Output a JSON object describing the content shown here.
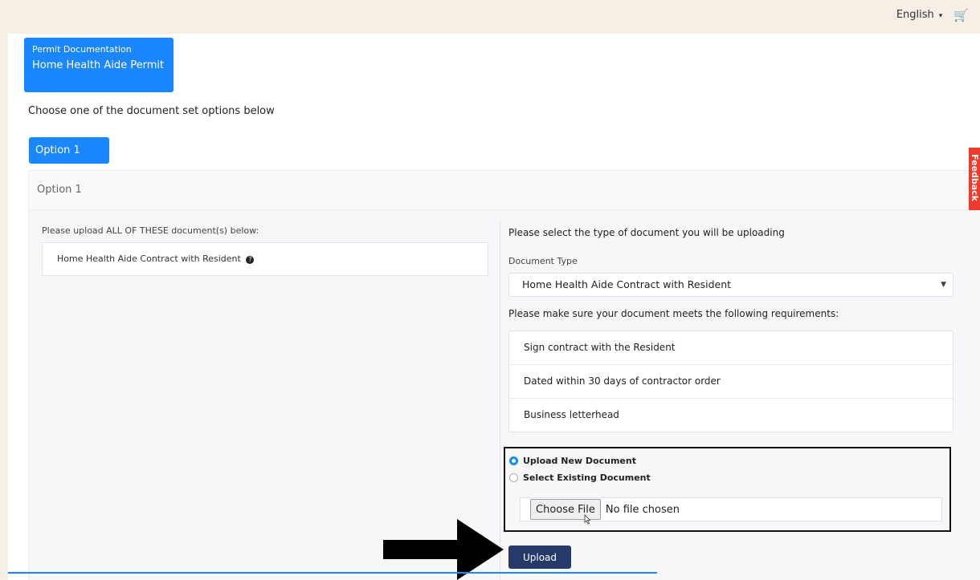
{
  "header": {
    "language": "English",
    "language_caret": "▾",
    "cart_icon": "🛒"
  },
  "permit": {
    "label": "Permit Documentation",
    "name": "Home Health Aide Permit"
  },
  "instructions": "Choose one of the document set options below",
  "option_tab": {
    "label": "Option 1"
  },
  "option_card": {
    "title": "Option 1",
    "left": {
      "label": "Please upload ALL OF THESE document(s) below:",
      "documents": [
        "Home Health Aide Contract with Resident"
      ]
    },
    "right": {
      "heading": "Please select the type of document you will be uploading",
      "doc_type_label": "Document Type",
      "doc_type_value": "Home Health Aide Contract with Resident",
      "requirements_heading": "Please make sure your document meets the following requirements:",
      "requirements": [
        "Sign contract with the Resident",
        "Dated within 30 days of contractor order",
        "Business letterhead"
      ],
      "radio_upload_new": "Upload New Document",
      "radio_select_existing": "Select Existing Document",
      "choose_file_label": "Choose File",
      "file_status": "No file chosen",
      "upload_label": "Upload"
    }
  },
  "feedback_tab": "Feedback",
  "colors": {
    "accent": "#1a86ff",
    "upload_button": "#263a6a",
    "feedback": "#ef3a2e"
  }
}
